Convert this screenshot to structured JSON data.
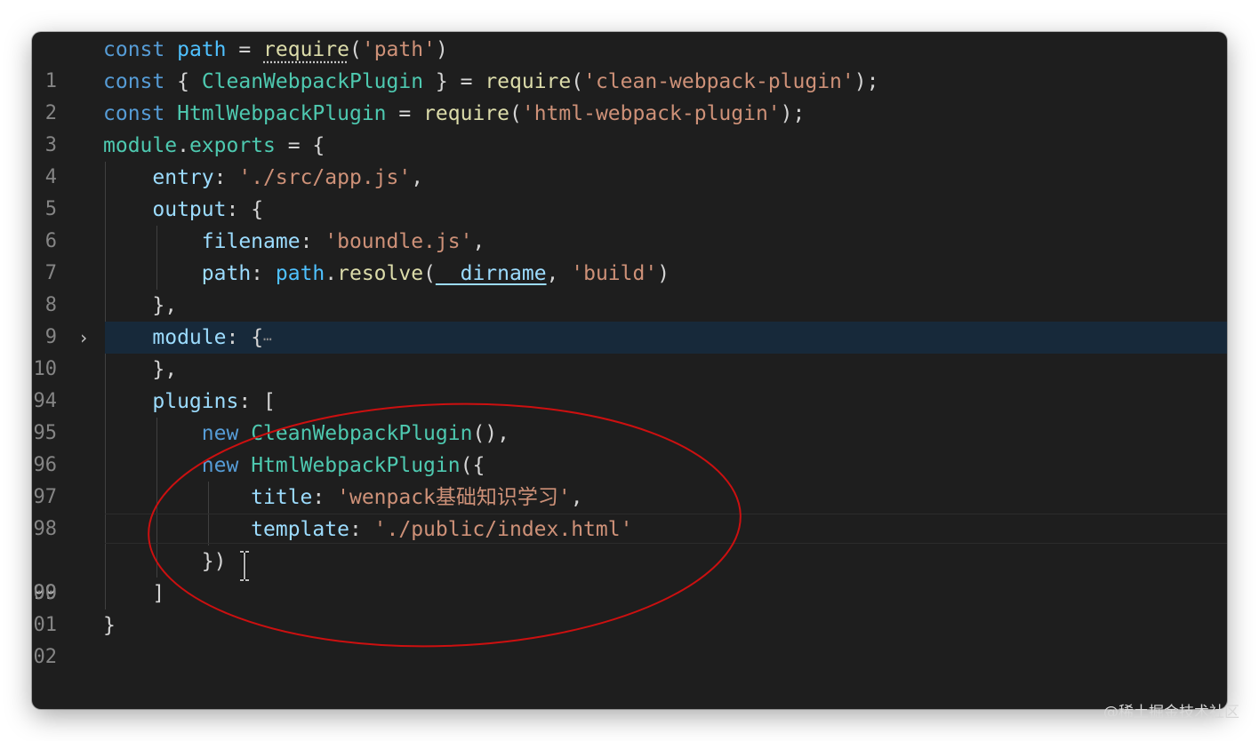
{
  "editor": {
    "line_numbers": [
      "1",
      "2",
      "3",
      "4",
      "5",
      "6",
      "7",
      "8",
      "9",
      "10",
      "94",
      "95",
      "96",
      "97",
      "98",
      "99",
      "00",
      "01",
      "02"
    ],
    "active_line": "99",
    "folded_line": "10",
    "fold_ellipsis": "⋯",
    "tokens": {
      "const": "const",
      "path_var": "path",
      "eq": " = ",
      "require": "require",
      "paren_open": "(",
      "path_str": "'path'",
      "paren_close": ")",
      "brace_open": "{ ",
      "clean_plugin": "CleanWebpackPlugin",
      "brace_close": " }",
      "clean_str": "'clean-webpack-plugin'",
      "close_semicolon": ");",
      "html_plugin": "HtmlWebpackPlugin",
      "html_str": "'html-webpack-plugin'",
      "module": "module",
      "dot": ".",
      "exports": "exports",
      "obj_open": " = {",
      "entry_key": "entry",
      "colon": ": ",
      "entry_val": "'./src/app.js'",
      "comma": ",",
      "output_key": "output",
      "lbrace": "{",
      "filename_key": "filename",
      "filename_val": "'boundle.js'",
      "path_key": "path",
      "resolve": "resolve",
      "dirname": "__dirname",
      "comma_sp": ", ",
      "build_str": "'build'",
      "close_obj_comma": "},",
      "module_key": "module",
      "plugins_key": "plugins",
      "lbracket": "[",
      "new": "new",
      "call_comma": "(),",
      "call_open": "({",
      "title_key": "title",
      "title_val": "'wenpack基础知识学习'",
      "template_key": "template",
      "template_val": "'./public/index.html'",
      "close_call": "})",
      "rbracket": "]",
      "rbrace": "}"
    }
  },
  "annotation": {
    "ellipse_color": "#cc1010"
  },
  "watermark": "@稀土掘金技术社区"
}
